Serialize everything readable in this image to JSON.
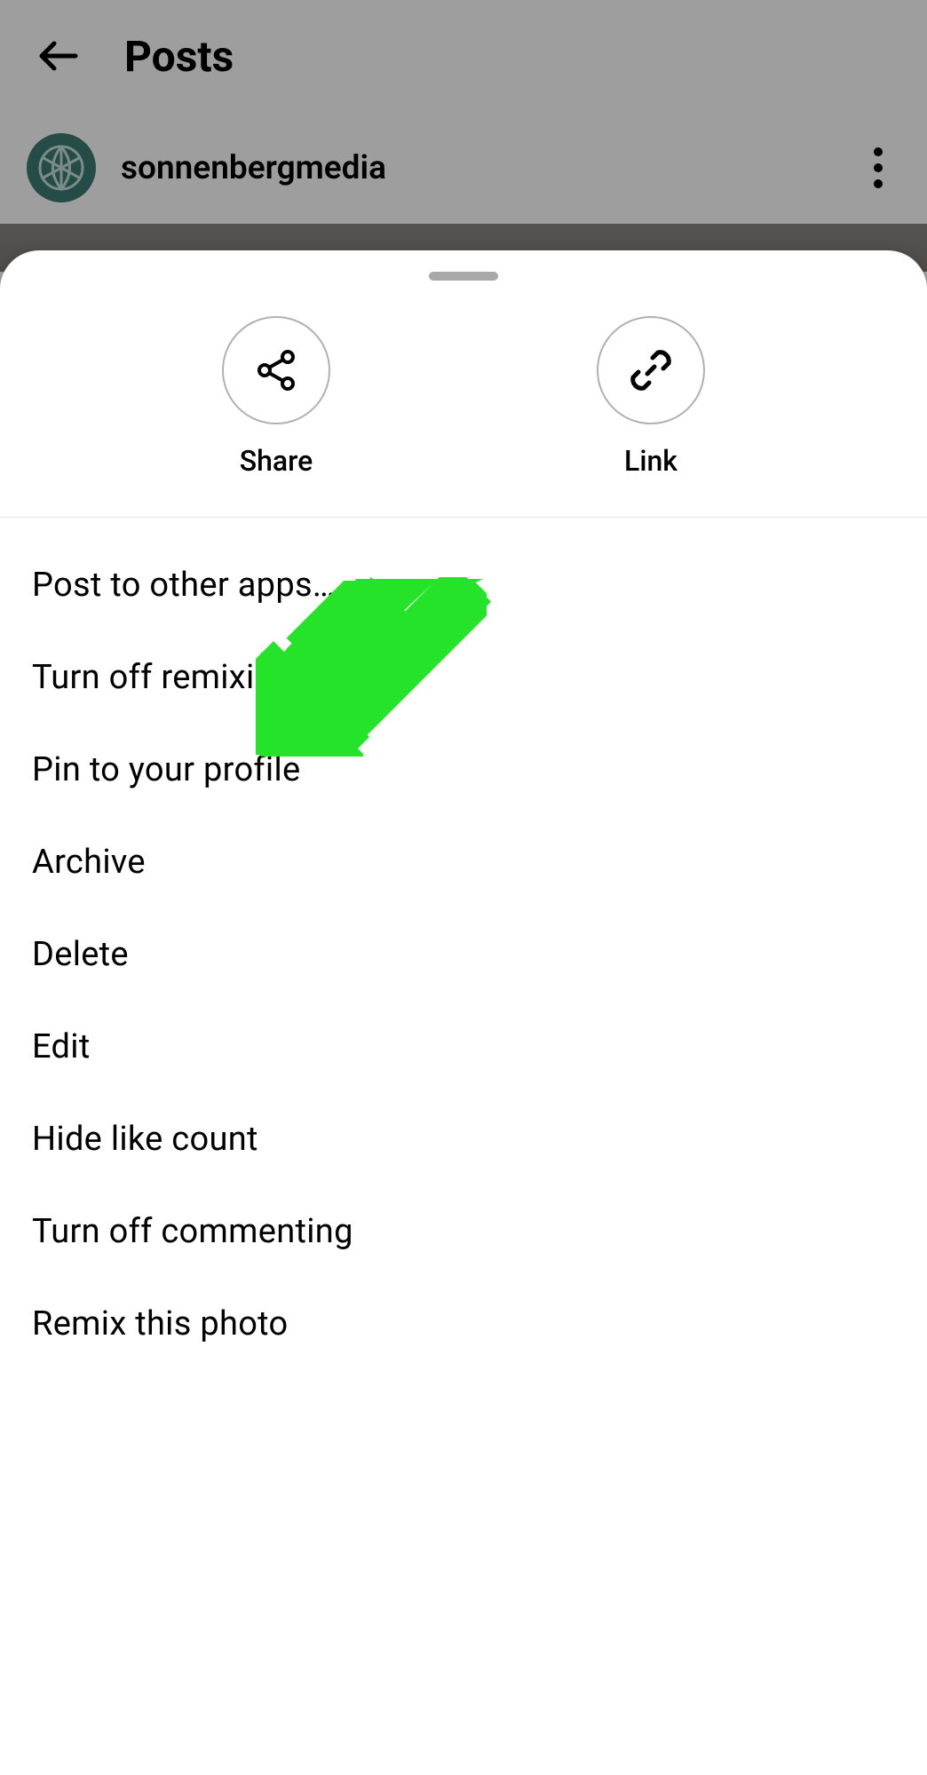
{
  "header": {
    "title": "Posts"
  },
  "post": {
    "username": "sonnenbergmedia"
  },
  "sheet": {
    "quick_actions": {
      "share": "Share",
      "link": "Link"
    },
    "menu": {
      "post_other_apps": "Post to other apps…",
      "turn_off_remixing": "Turn off remixing",
      "pin_profile": "Pin to your profile",
      "archive": "Archive",
      "delete": "Delete",
      "edit": "Edit",
      "hide_like_count": "Hide like count",
      "turn_off_commenting": "Turn off commenting",
      "remix_photo": "Remix this photo"
    }
  },
  "annotation": {
    "arrow_color": "#25e328"
  }
}
